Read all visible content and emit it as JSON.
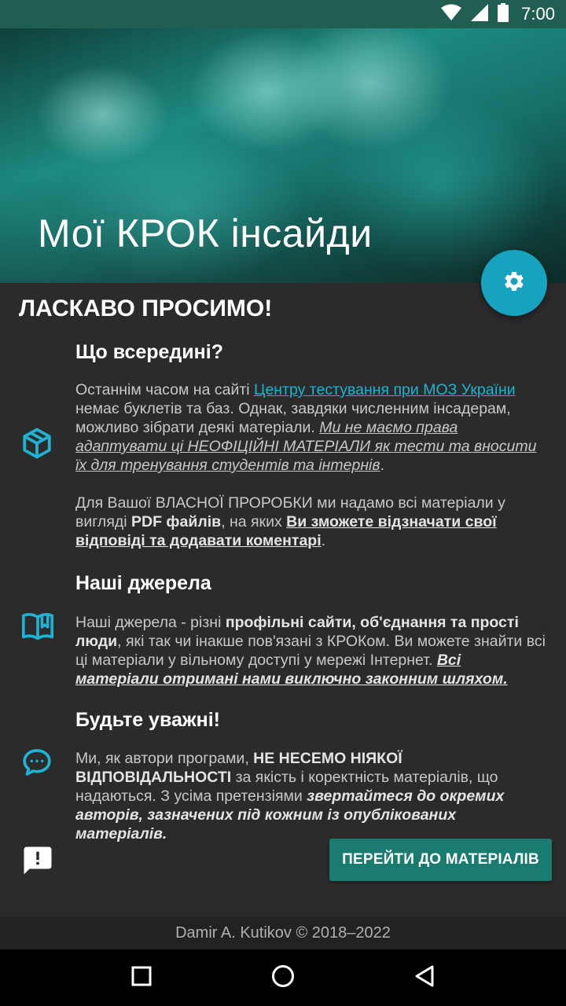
{
  "status": {
    "time": "7:00"
  },
  "hero": {
    "title": "Мої КРОК інсайди"
  },
  "welcome": "ЛАСКАВО ПРОСИМО!",
  "sections": {
    "inside": {
      "title": "Що всередині?",
      "p1_a": "Останнім часом на сайті ",
      "p1_link": "Центру тестування при МОЗ України",
      "p1_b": " немає буклетів та баз. Однак, завдяки численним інсадерам, можливо зібрати деякі матеріали. ",
      "p1_em": "Ми не маємо права адаптувати ці НЕОФІЦІЙНІ МАТЕРІАЛИ як тести та вносити їх для тренування студентів та інтернів",
      "p1_end": ".",
      "p2_a": "Для Вашої ВЛАСНОЇ ПРОРОБКИ ми надамо всі матеріали у вигляді ",
      "p2_b": "PDF файлів",
      "p2_c": ", на яких ",
      "p2_d": "Ви зможете відзначати свої відповіді та додавати коментарі",
      "p2_end": "."
    },
    "sources": {
      "title": "Наші джерела",
      "p_a": "Наші джерела - різні ",
      "p_b": "профільні сайти, об'єднання та прості люди",
      "p_c": ", які так чи інакше пов'язані з КРОКом. Ви можете знайти всі ці матеріали у вільному доступі у мережі Інтернет. ",
      "p_d": "Всі матеріали отримані нами виключно законним шляхом."
    },
    "attention": {
      "title": "Будьте уважні!",
      "p_a": "Ми, як автори програми, ",
      "p_b": "НЕ НЕСЕМО НІЯКОЇ ВІДПОВІДАЛЬНОСТІ",
      "p_c": " за якість і коректність матеріалів, що надаються. З усіма претензіями ",
      "p_d": "звертайтеся до окремих авторів, зазначених під кожним із опублікованих матеріалів."
    }
  },
  "button": {
    "go_label": "ПЕРЕЙТИ ДО МАТЕРІАЛІВ"
  },
  "footer": {
    "text": "Damir A. Kutikov © 2018–2022"
  },
  "icons": {
    "settings": "gear-icon",
    "inside": "cube-icon",
    "sources": "open-book-icon",
    "attention": "speech-bubble-dots-icon",
    "feedback": "feedback-alert-icon"
  },
  "colors": {
    "accent": "#1fb3d1",
    "fab": "#17a3c0",
    "button": "#1a7c70",
    "status_bar": "#1f5e50",
    "background": "#2b2b2b"
  }
}
